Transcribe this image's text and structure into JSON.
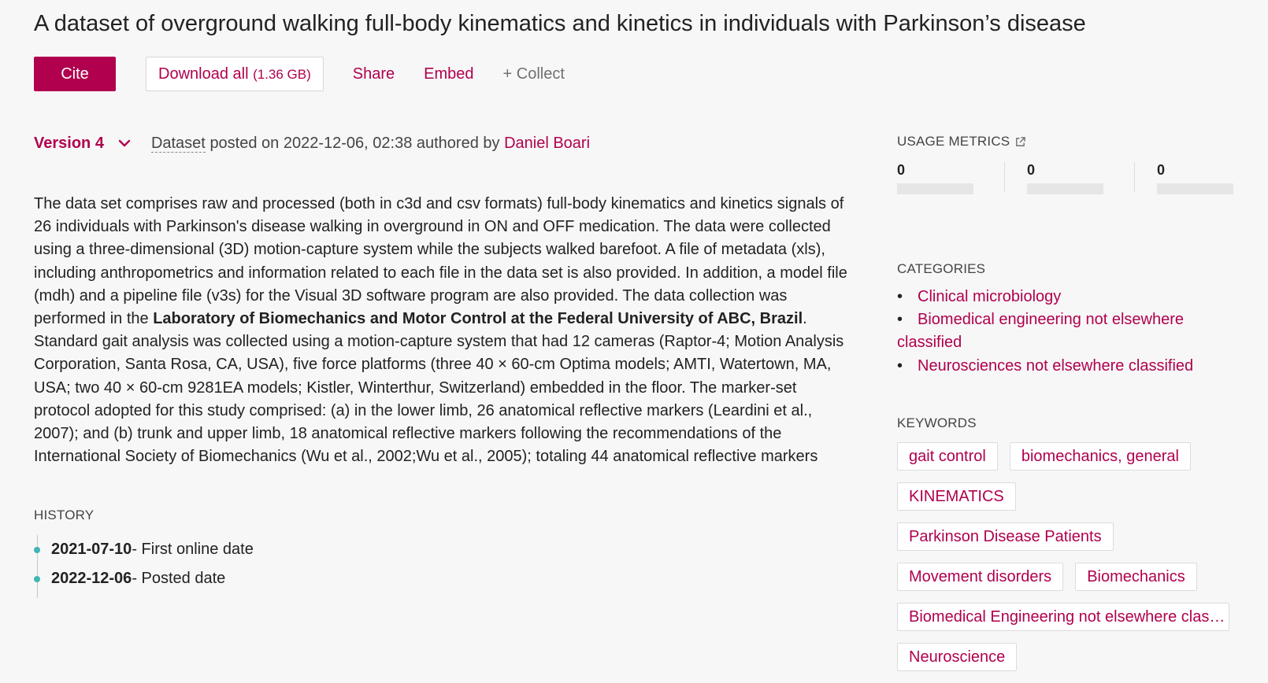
{
  "title": "A dataset of overground walking full-body kinematics and kinetics in individuals with Parkinson’s disease",
  "actions": {
    "cite": "Cite",
    "download_label": "Download all",
    "download_size": "(1.36 GB)",
    "share": "Share",
    "embed": "Embed",
    "collect": "+ Collect"
  },
  "version": {
    "label": "Version 4"
  },
  "posted": {
    "type": "Dataset",
    "text": "posted on 2022-12-06, 02:38 authored by",
    "author": "Daniel Boari"
  },
  "description": {
    "part1": "The data set comprises raw and processed (both in c3d and csv formats) full-body kinematics and kinetics signals of 26 individuals with Parkinson's disease walking in overground in ON and OFF medication. The data were collected using a three-dimensional (3D) motion-capture system while the subjects walked barefoot. A file of metadata (xls), including anthropometrics and information related to each file in the data set is also provided. In addition, a model file (mdh) and a pipeline file (v3s) for the Visual 3D software program are also provided.  The data collection was performed in the",
    "bold": "Laboratory of Biomechanics and Motor Control at the Federal University of ABC, Brazil",
    "part2": ". Standard gait analysis was collected using a motion-capture system that had 12 cameras (Raptor-4; Motion Analysis Corporation, Santa Rosa, CA, USA), five force platforms (three 40 × 60-cm Optima models; AMTI, Watertown, MA, USA; two 40 × 60-cm 9281EA models; Kistler, Winterthur, Switzerland) embedded in the floor.  The marker-set protocol adopted for this study comprised: (a) in the lower limb, 26 anatomical reflective markers (Leardini et al., 2007); and (b) trunk and upper limb, 18 anatomical reflective markers following the recommendations of the International Society of Biomechanics (Wu et al., 2002;Wu et al., 2005); totaling 44 anatomical reflective markers"
  },
  "history": {
    "label": "HISTORY",
    "items": [
      {
        "date": "2021-07-10",
        "event": " - First online date"
      },
      {
        "date": "2022-12-06",
        "event": " - Posted date"
      }
    ]
  },
  "sidebar": {
    "usage_label": "USAGE METRICS",
    "metrics": [
      "0",
      "0",
      "0"
    ],
    "categories_label": "CATEGORIES",
    "categories": [
      "Clinical microbiology",
      "Biomedical engineering not elsewhere classified",
      "Neurosciences not elsewhere classified"
    ],
    "keywords_label": "KEYWORDS",
    "keywords": [
      "gait control",
      "biomechanics, general",
      "KINEMATICS",
      "Parkinson Disease Patients",
      "Movement disorders",
      "Biomechanics",
      "Biomedical Engineering not elsewhere clas…",
      "Neuroscience"
    ]
  },
  "colors": {
    "accent": "#b0004e",
    "timeline_dot": "#3fb5b5",
    "background": "#f7f7f7"
  },
  "icons": {
    "version_toggle": "chevron-down-icon",
    "usage_link": "external-link-icon"
  }
}
